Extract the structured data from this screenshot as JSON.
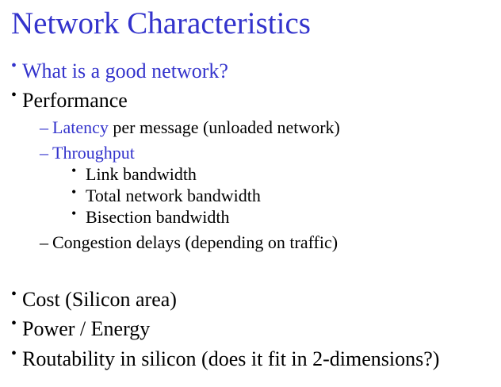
{
  "colors": {
    "accent": "#3333cc",
    "text": "#000000",
    "background": "#ffffff"
  },
  "slide": {
    "title": "Network Characteristics",
    "bullet_glyph": "•",
    "dash_glyph": "–",
    "items": [
      {
        "text": "What is a good network?"
      },
      {
        "text": "Performance"
      },
      {
        "highlight": "Latency",
        "rest": " per message (unloaded network)"
      },
      {
        "text": "Throughput"
      },
      {
        "text": "Link bandwidth"
      },
      {
        "text": "Total network bandwidth"
      },
      {
        "text": "Bisection bandwidth"
      },
      {
        "text": "Congestion delays (depending on traffic)"
      },
      {
        "text": "Cost (Silicon area)"
      },
      {
        "text": "Power / Energy"
      },
      {
        "text": "Routability in silicon (does it fit in 2-dimensions?)"
      }
    ]
  }
}
